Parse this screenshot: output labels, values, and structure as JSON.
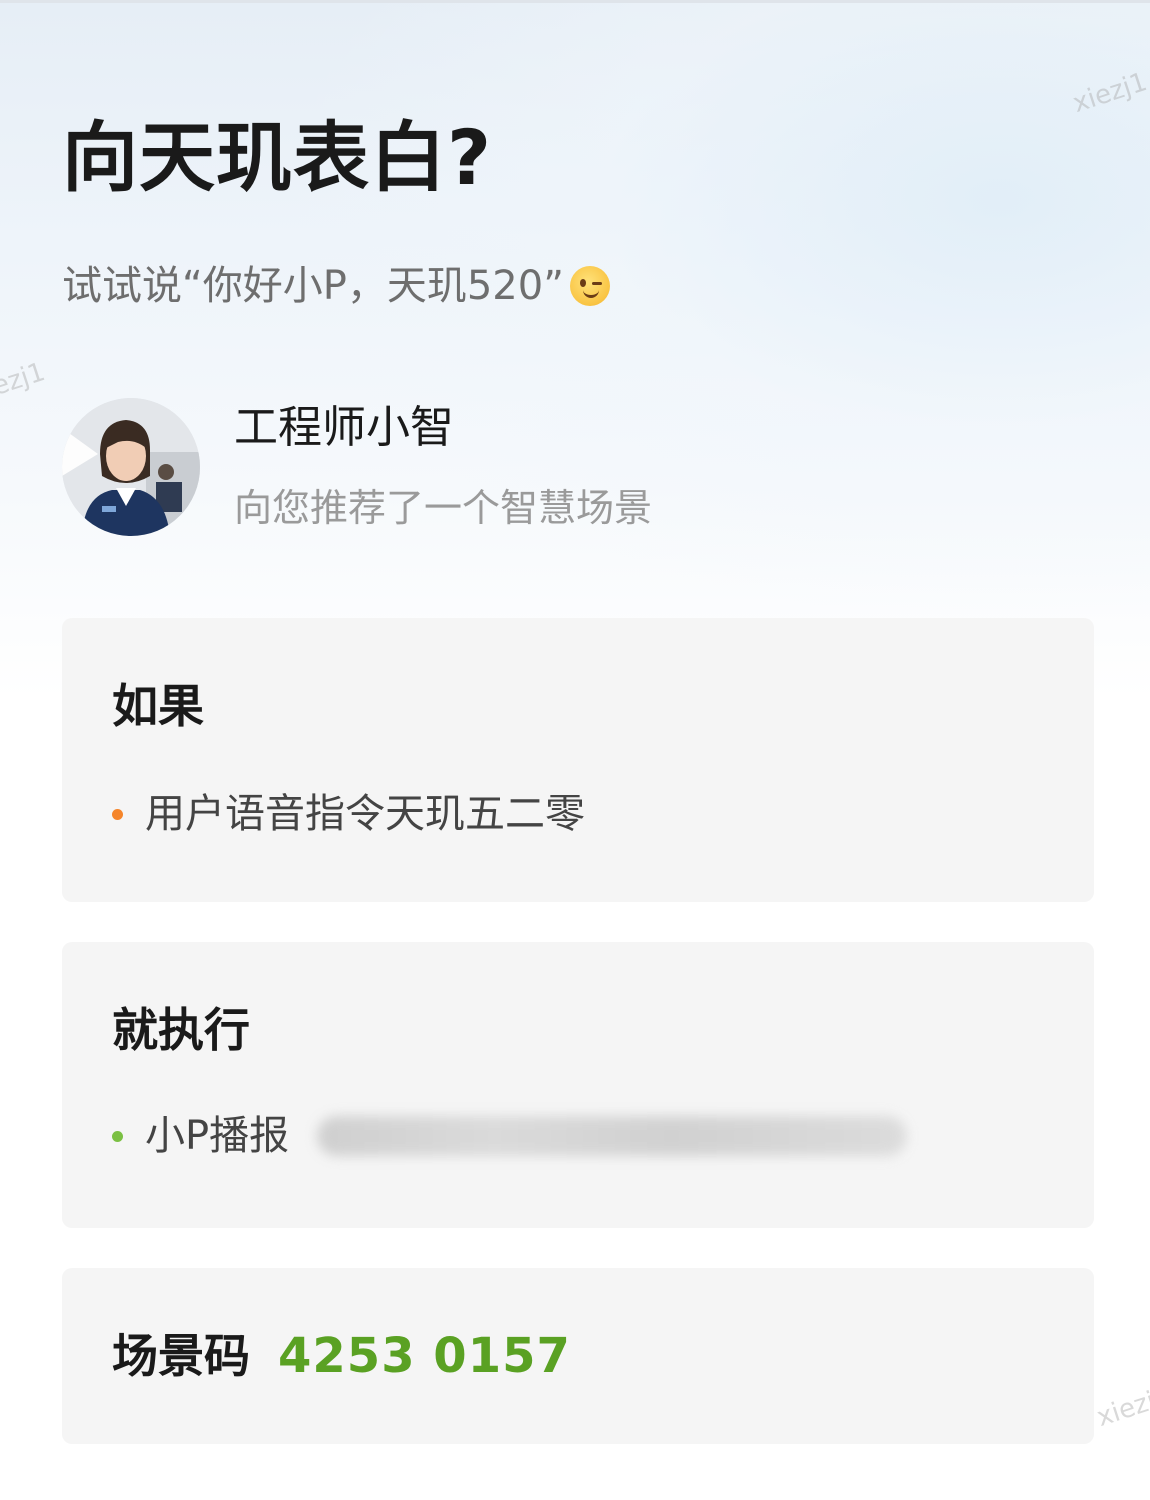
{
  "header": {
    "title": "向天玑表白?",
    "subtitle": "试试说“你好小P，天玑520”"
  },
  "author": {
    "name": "工程师小智",
    "description": "向您推荐了一个智慧场景"
  },
  "if_card": {
    "title": "如果",
    "item": "用户语音指令天玑五二零",
    "dot_color": "#f5852a"
  },
  "then_card": {
    "title": "就执行",
    "item": "小P播报",
    "dot_color": "#7bc043"
  },
  "code_card": {
    "label": "场景码",
    "value": "4253 0157",
    "value_color": "#5aa123"
  },
  "watermark": "xiezj1",
  "icons": {
    "emoji": "winking-face-icon"
  }
}
